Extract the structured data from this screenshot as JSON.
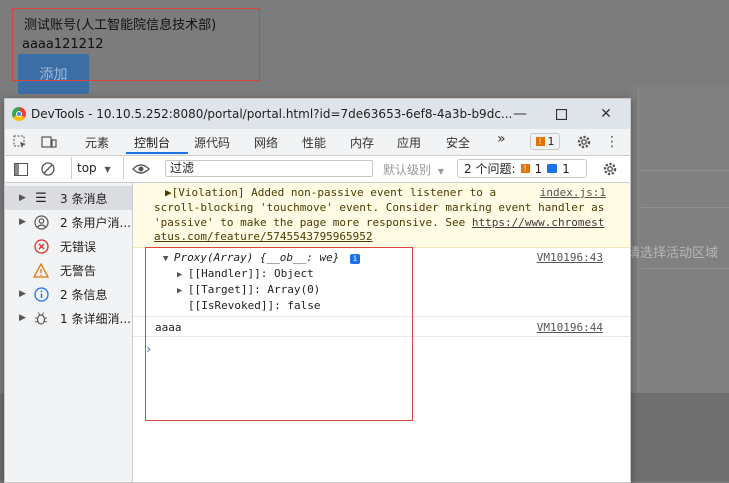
{
  "page": {
    "account_title": "测试账号(人工智能院信息技术部)",
    "account_value": "aaaa121212",
    "add_button": "添加",
    "right_hint": "请选择活动区域"
  },
  "devtools": {
    "window_title": "DevTools - 10.10.5.252:8080/portal/portal.html?id=7de63653-6ef8-4a3b-b9dc...",
    "tabs": [
      "元素",
      "控制台",
      "源代码",
      "网络",
      "性能",
      "内存",
      "应用",
      "安全"
    ],
    "active_tab": "控制台",
    "more_tabs": "»",
    "issue_count_badge": "1",
    "context_select": "top",
    "filter_value": "过滤",
    "levels_label": "默认级别",
    "issues_label": "2 个问题:",
    "issues_warn_count": "1",
    "issues_info_count": "1",
    "sidebar": [
      {
        "label": "3 条消息",
        "icon": "list-icon",
        "arrow": true,
        "selected": true
      },
      {
        "label": "2 条用户消...",
        "icon": "user-icon",
        "arrow": true,
        "selected": false
      },
      {
        "label": "无错误",
        "icon": "error-icon",
        "arrow": false,
        "selected": false
      },
      {
        "label": "无警告",
        "icon": "warning-icon",
        "arrow": false,
        "selected": false
      },
      {
        "label": "2 条信息",
        "icon": "info-icon",
        "arrow": true,
        "selected": false
      },
      {
        "label": "1 条详细消...",
        "icon": "bug-icon",
        "arrow": true,
        "selected": false
      }
    ],
    "console": {
      "violation_lines": [
        "▶[Violation] Added non-passive event listener to a",
        "scroll-blocking 'touchmove' event. Consider marking event handler as",
        "'passive' to make the page more responsive. See",
        "atus.com/feature/5745543795965952"
      ],
      "violation_url_part": "https://www.chromest",
      "violation_source": "index.js:1",
      "proxy_header": "Proxy(Array) {__ob__: we}",
      "proxy_source": "VM10196:43",
      "proxy_props": [
        {
          "key": "[[Handler]]",
          "value": "Object",
          "expandable": true
        },
        {
          "key": "[[Target]]",
          "value": "Array(0)",
          "expandable": true
        },
        {
          "key": "[[IsRevoked]]",
          "value": "false",
          "expandable": false
        }
      ],
      "log_text": "aaaa",
      "log_source": "VM10196:44",
      "prompt_symbol": "›"
    }
  },
  "colors": {
    "accent": "#1a73e8",
    "warning_bg": "#fffbe5",
    "highlight_box": "#d9453a",
    "add_button": "#3a6ea5"
  }
}
